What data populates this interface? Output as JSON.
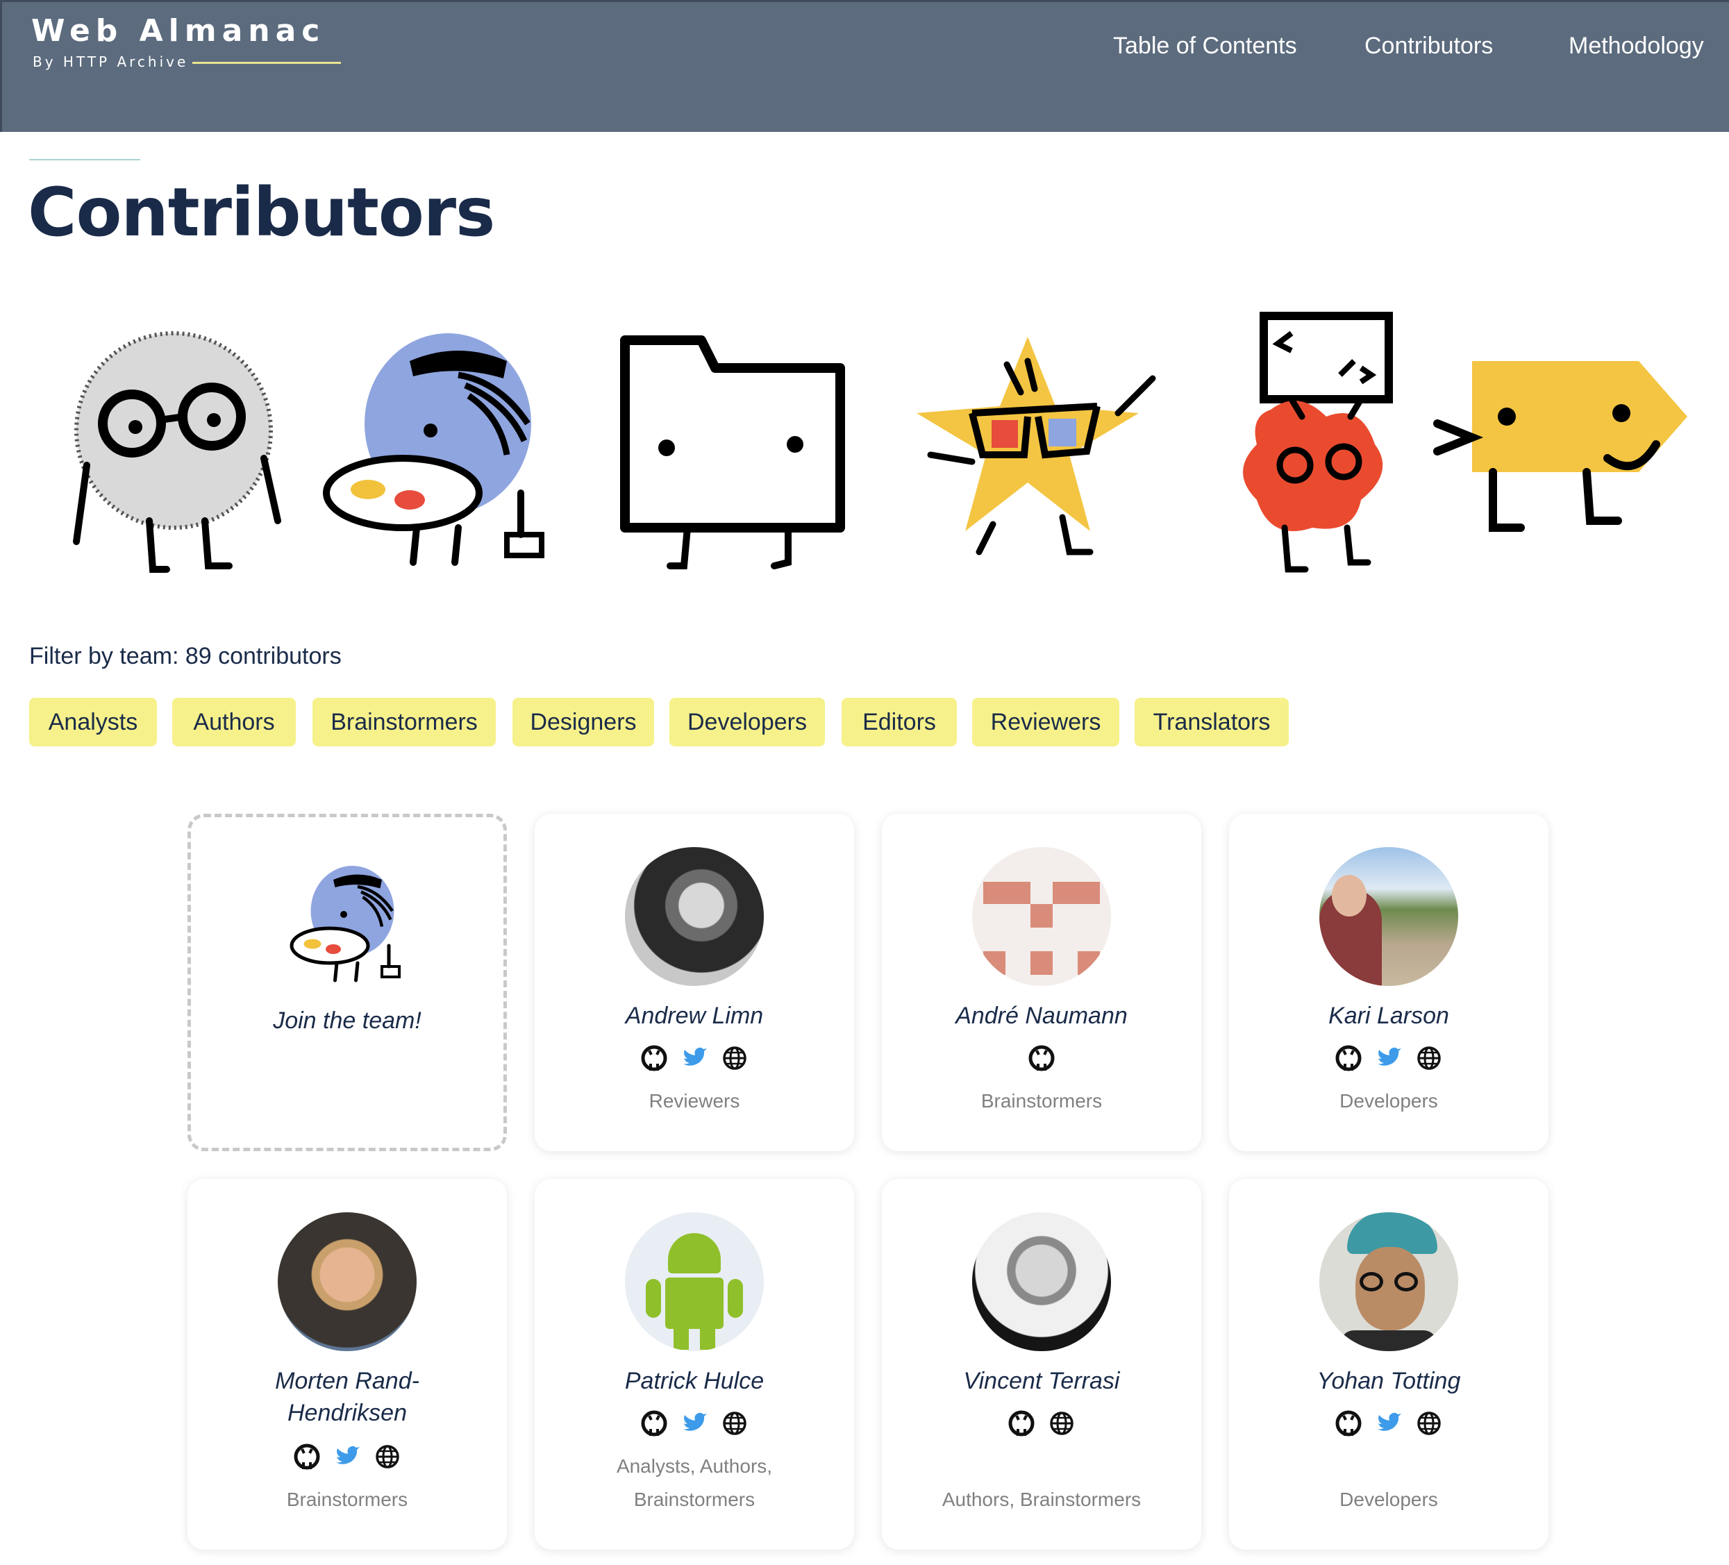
{
  "header": {
    "logo_title": "Web Almanac",
    "logo_subtitle": "By HTTP Archive",
    "nav": [
      "Table of Contents",
      "Contributors",
      "Methodology"
    ]
  },
  "page_title": "Contributors",
  "filter": {
    "label": "Filter by team: 89 contributors",
    "teams": [
      "Analysts",
      "Authors",
      "Brainstormers",
      "Designers",
      "Developers",
      "Editors",
      "Reviewers",
      "Translators"
    ]
  },
  "join_card": {
    "label": "Join the team!"
  },
  "contributors": [
    {
      "name": "Andrew Limn",
      "teams": "Reviewers",
      "icons": [
        "github-icon",
        "twitter-icon",
        "website-icon"
      ]
    },
    {
      "name": "André Naumann",
      "teams": "Brainstormers",
      "icons": [
        "github-icon"
      ]
    },
    {
      "name": "Kari Larson",
      "teams": "Developers",
      "icons": [
        "github-icon",
        "twitter-icon",
        "website-icon"
      ]
    },
    {
      "name": "Morten Rand-Hendriksen",
      "name_lines": [
        "Morten Rand-",
        "Hendriksen"
      ],
      "teams": "Brainstormers",
      "icons": [
        "github-icon",
        "twitter-icon",
        "website-icon"
      ]
    },
    {
      "name": "Patrick Hulce",
      "teams": "Analysts, Authors, Brainstormers",
      "team_lines": [
        "Analysts, Authors,",
        "Brainstormers"
      ],
      "icons": [
        "github-icon",
        "twitter-icon",
        "website-icon"
      ]
    },
    {
      "name": "Vincent Terrasi",
      "teams": "Authors, Brainstormers",
      "icons": [
        "github-icon",
        "website-icon"
      ]
    },
    {
      "name": "Yohan Totting",
      "teams": "Developers",
      "icons": [
        "github-icon",
        "twitter-icon",
        "website-icon"
      ]
    }
  ],
  "colors": {
    "header_bg": "#5c6b7e",
    "chip_bg": "#f6f18a",
    "title_text": "#1a2b49",
    "twitter": "#3d9be9",
    "team_text": "#808080"
  }
}
